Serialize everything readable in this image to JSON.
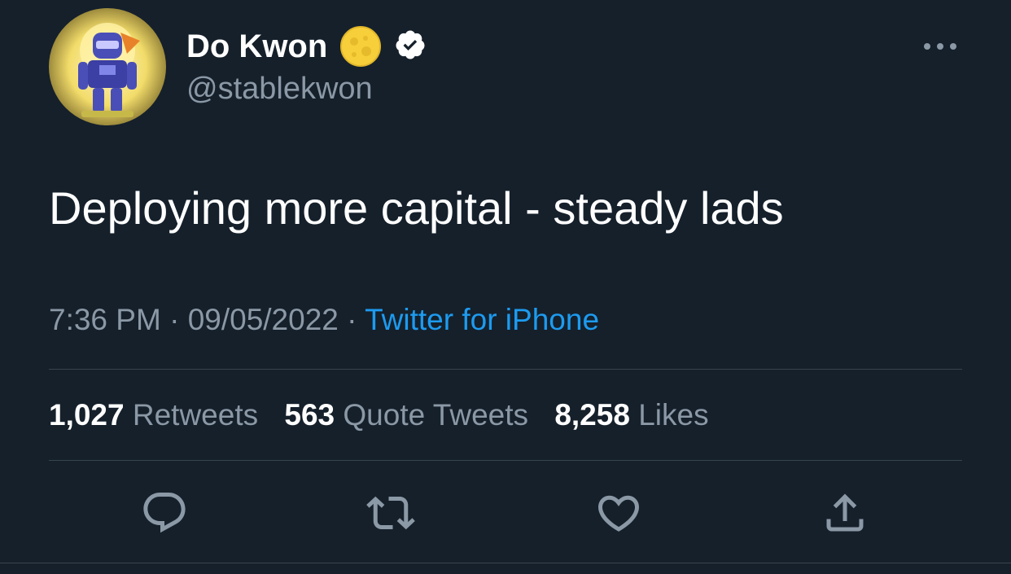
{
  "user": {
    "display_name": "Do Kwon",
    "handle": "@stablekwon",
    "badge_icon": "moon-icon",
    "verified_icon": "verified-badge-icon",
    "avatar_icon": "robot-avatar-icon"
  },
  "tweet": {
    "text": "Deploying more capital - steady lads",
    "time": "7:36 PM",
    "separator": "·",
    "date": "09/05/2022",
    "source": "Twitter for iPhone"
  },
  "stats": {
    "retweets_count": "1,027",
    "retweets_label": "Retweets",
    "quotes_count": "563",
    "quotes_label": "Quote Tweets",
    "likes_count": "8,258",
    "likes_label": "Likes"
  },
  "actions": [
    {
      "icon": "reply-icon"
    },
    {
      "icon": "retweet-icon"
    },
    {
      "icon": "like-heart-icon"
    },
    {
      "icon": "share-icon"
    }
  ],
  "colors": {
    "background": "#15202b",
    "primary_text": "#ffffff",
    "secondary_text": "#8b98a5",
    "link": "#1d9bf0",
    "divider": "#38444d"
  }
}
